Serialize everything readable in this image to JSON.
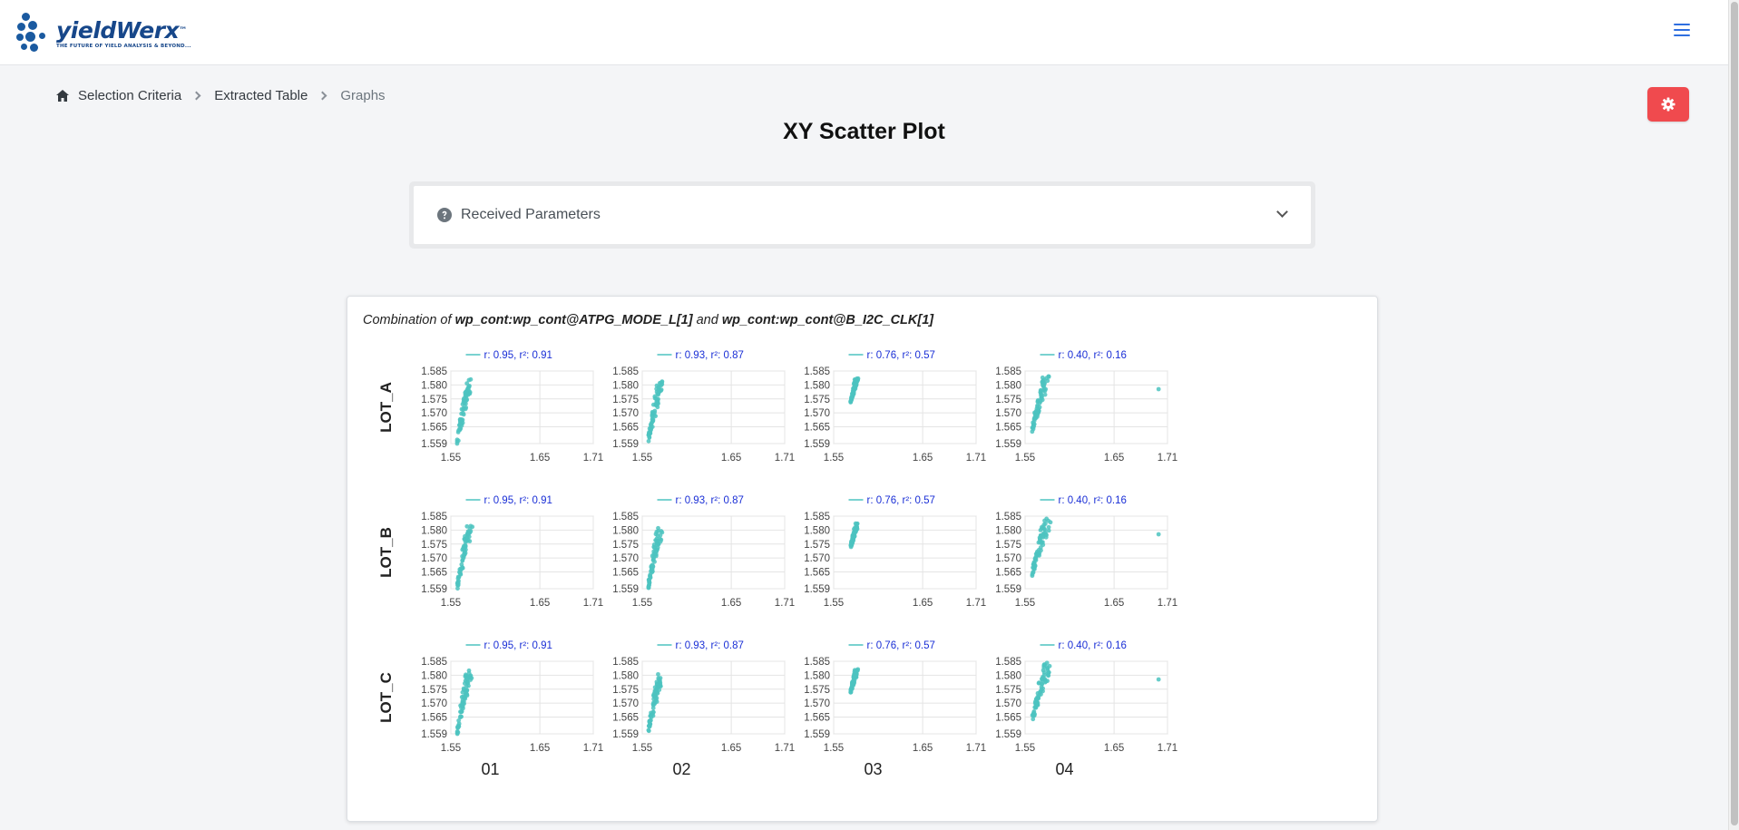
{
  "app": {
    "logo_name": "yieldWerx",
    "logo_tm": "™",
    "logo_tagline": "THE FUTURE OF YIELD ANALYSIS & BEYOND..."
  },
  "breadcrumb": {
    "items": [
      "Selection Criteria",
      "Extracted Table"
    ],
    "current": "Graphs"
  },
  "page_title": "XY Scatter Plot",
  "params_panel": {
    "label": "Received Parameters",
    "expanded": false
  },
  "plot_card": {
    "subtitle_prefix": "Combination of",
    "param_x": "wp_cont:wp_cont@ATPG_MODE_L[1]",
    "subtitle_and": "and",
    "param_y": "wp_cont:wp_cont@B_I2C_CLK[1]"
  },
  "colors": {
    "accent": "#f04a4e",
    "point": "#4cc3c0",
    "legend_text": "#1a2fd6"
  },
  "chart_data": {
    "type": "scatter",
    "layout": "grid",
    "rows": [
      "LOT_A",
      "LOT_B",
      "LOT_C"
    ],
    "cols": [
      "01",
      "02",
      "03",
      "04"
    ],
    "xlim": [
      1.55,
      1.71
    ],
    "ylim": [
      1.559,
      1.585
    ],
    "xticks": [
      "1.55",
      "1.65",
      "1.71"
    ],
    "yticks": [
      "1.585",
      "1.580",
      "1.575",
      "1.570",
      "1.565",
      "1.559"
    ],
    "grid": true,
    "legend_placement": "top-center",
    "col_stats": [
      {
        "r": "0.95",
        "r2": "0.91",
        "legend": "r: 0.95, r²: 0.91"
      },
      {
        "r": "0.93",
        "r2": "0.87",
        "legend": "r: 0.93, r²: 0.87"
      },
      {
        "r": "0.76",
        "r2": "0.57",
        "legend": "r: 0.76, r²: 0.57"
      },
      {
        "r": "0.40",
        "r2": "0.16",
        "legend": "r: 0.40, r²: 0.16"
      }
    ],
    "cluster_shape": [
      {
        "x_min": 1.557,
        "x_max": 1.575,
        "y_min": 1.5595,
        "y_max": 1.5815,
        "outliers": []
      },
      {
        "x_min": 1.557,
        "x_max": 1.574,
        "y_min": 1.5605,
        "y_max": 1.5805,
        "outliers": []
      },
      {
        "x_min": 1.569,
        "x_max": 1.578,
        "y_min": 1.574,
        "y_max": 1.582,
        "outliers": []
      },
      {
        "x_min": 1.558,
        "x_max": 1.58,
        "y_min": 1.5645,
        "y_max": 1.5835,
        "outliers": [
          [
            1.7,
            1.5785
          ]
        ]
      }
    ],
    "points_per_panel": 70
  }
}
